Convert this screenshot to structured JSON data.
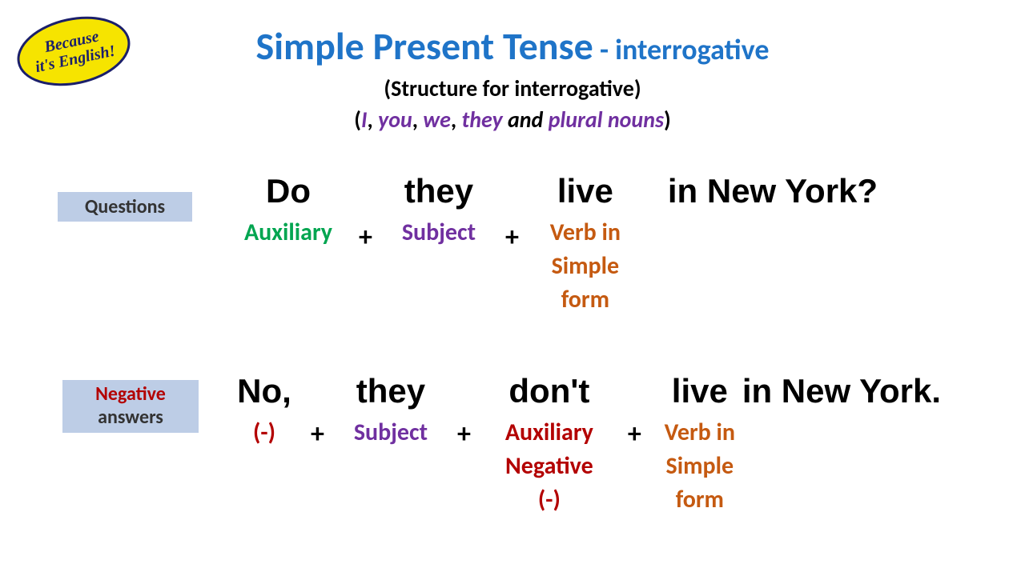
{
  "logo": {
    "line1": "Because",
    "line2": "it's English!"
  },
  "title": {
    "main": "Simple Present Tense",
    "sep": " - ",
    "sub": "interrogative"
  },
  "subtitle1": "(Structure for interrogative)",
  "subtitle2": {
    "open": "(",
    "i": "I",
    "c1": ", ",
    "you": "you",
    "c2": ", ",
    "we": "we",
    "c3": ", ",
    "they": "they",
    "and": " and ",
    "plural": "plural nouns",
    "close": ")"
  },
  "labels": {
    "questions": "Questions",
    "negative": "Negative",
    "answers": "answers"
  },
  "q": {
    "w1": "Do",
    "w2": "they",
    "w3": "live",
    "w4": "in New York?",
    "r1": "Auxiliary",
    "r2": "Subject",
    "r3a": "Verb in",
    "r3b": "Simple",
    "r3c": "form",
    "plus": "+"
  },
  "n": {
    "w1": "No,",
    "w2": "they",
    "w3": "don't",
    "w4": "live",
    "w5": "in New York.",
    "r1": "(-)",
    "r2": "Subject",
    "r3a": "Auxiliary",
    "r3b": "Negative",
    "r3c": "(-)",
    "r4a": "Verb in",
    "r4b": "Simple",
    "r4c": "form",
    "plus": "+"
  }
}
